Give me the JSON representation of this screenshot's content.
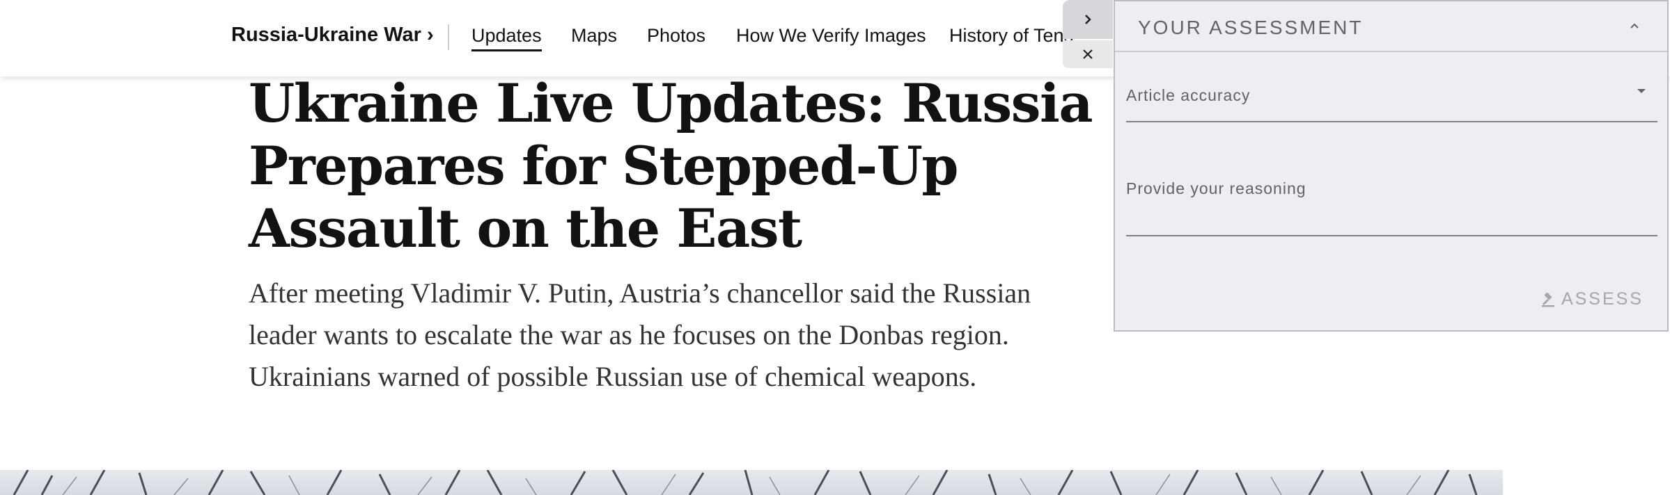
{
  "nav": {
    "section_label": "Russia-Ukraine War",
    "section_arrow": "›",
    "items": [
      {
        "label": "Updates",
        "active": true
      },
      {
        "label": "Maps"
      },
      {
        "label": "Photos"
      },
      {
        "label": "How We Verify Images"
      },
      {
        "label": "History of Tens"
      }
    ]
  },
  "article": {
    "headline": "Ukraine Live Updates: Russia Prepares for Stepped-Up Assault on the East",
    "summary": "After meeting Vladimir V. Putin, Austria’s chancellor said the Russian leader wants to escalate the war as he focuses on the Donbas region. Ukrainians warned of possible Russian use of chemical weapons."
  },
  "panel": {
    "title": "YOUR ASSESSMENT",
    "accuracy_label": "Article accuracy",
    "reasoning_label": "Provide your reasoning",
    "assess_label": "ASSESS",
    "icons": {
      "collapse": "chevron-up-icon",
      "expand": "chevron-right-icon",
      "close": "close-icon",
      "dropdown": "caret-down-icon",
      "assess": "gavel-icon"
    }
  },
  "colors": {
    "panel_bg": "#eceef1",
    "panel_text": "#5f6368",
    "disabled_text": "#a4a8ae",
    "headline_text": "#121212"
  }
}
